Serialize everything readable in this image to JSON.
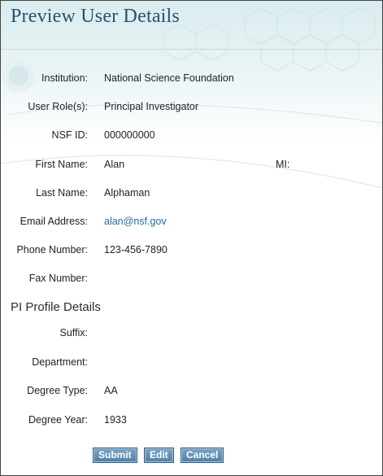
{
  "header": {
    "title": "Preview User Details"
  },
  "user": {
    "fields": [
      {
        "label": "Institution:",
        "value": "National Science Foundation"
      },
      {
        "label": "User Role(s):",
        "value": "Principal Investigator"
      },
      {
        "label": "NSF ID:",
        "value": "000000000"
      },
      {
        "label": "First Name:",
        "value": "Alan"
      },
      {
        "label": "Last Name:",
        "value": "Alphaman"
      },
      {
        "label": "Email Address:",
        "value": "alan@nsf.gov"
      },
      {
        "label": "Phone Number:",
        "value": "123-456-7890"
      },
      {
        "label": "Fax Number:",
        "value": ""
      }
    ],
    "mi_label": "MI:",
    "mi_value": ""
  },
  "profile": {
    "title": "PI Profile Details",
    "fields": [
      {
        "label": "Suffix:",
        "value": ""
      },
      {
        "label": "Department:",
        "value": ""
      },
      {
        "label": "Degree Type:",
        "value": "AA"
      },
      {
        "label": "Degree Year:",
        "value": "1933"
      }
    ]
  },
  "actions": {
    "submit": "Submit",
    "edit": "Edit",
    "cancel": "Cancel"
  },
  "colors": {
    "title": "#2b4f6e",
    "link": "#1f6e9a",
    "button": "#4f7fa6"
  }
}
